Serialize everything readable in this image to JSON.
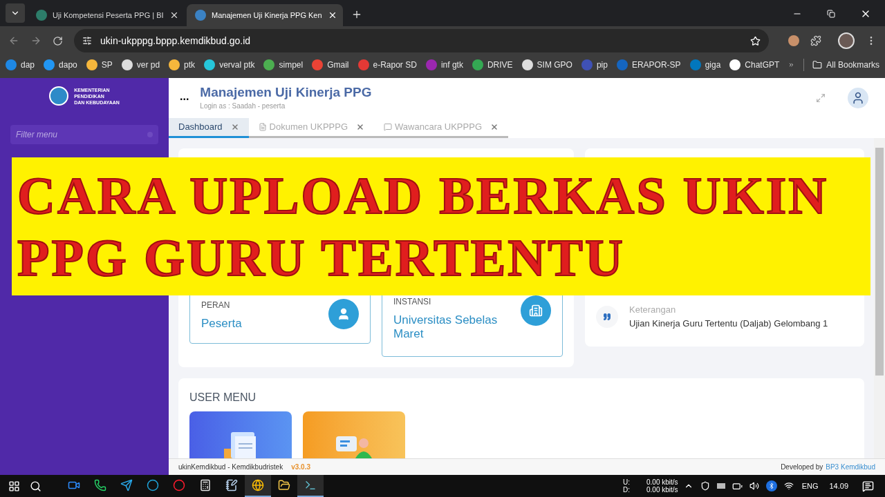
{
  "browser": {
    "tabs": [
      {
        "title": "Uji Kompetensi Peserta PPG | BI",
        "selected": false
      },
      {
        "title": "Manajemen Uji Kinerja PPG Ken",
        "selected": true
      }
    ],
    "address": "ukin-ukpppg.bppp.kemdikbud.go.id",
    "bookmarks": [
      {
        "label": "dap"
      },
      {
        "label": "dapo"
      },
      {
        "label": "SP"
      },
      {
        "label": "ver pd"
      },
      {
        "label": "ptk"
      },
      {
        "label": "verval ptk"
      },
      {
        "label": "simpel"
      },
      {
        "label": "Gmail"
      },
      {
        "label": "e-Rapor SD"
      },
      {
        "label": "inf gtk"
      },
      {
        "label": "DRIVE"
      },
      {
        "label": "SIM GPO"
      },
      {
        "label": "pip"
      },
      {
        "label": "ERAPOR-SP"
      },
      {
        "label": "giga"
      },
      {
        "label": "ChatGPT"
      }
    ],
    "all_bookmarks": "All Bookmarks"
  },
  "sidebar": {
    "logo_lines": [
      "KEMENTERIAN",
      "PENDIDIKAN",
      "DAN KEBUDAYAAN"
    ],
    "filter_placeholder": "Filter menu"
  },
  "header": {
    "menu_dots": "...",
    "title": "Manajemen Uji Kinerja PPG",
    "subtitle": "Login as : Saadah - peserta"
  },
  "app_tabs": [
    {
      "label": "Dashboard",
      "selected": true,
      "kind": "plain"
    },
    {
      "label": "Dokumen UKPPPG",
      "selected": false,
      "kind": "document"
    },
    {
      "label": "Wawancara UKPPPG",
      "selected": false,
      "kind": "chat"
    }
  ],
  "profile_cards": [
    {
      "label": "PERAN",
      "value": "Peserta",
      "kind": "user"
    },
    {
      "label": "INSTANSI",
      "value": "Universitas Sebelas Maret",
      "kind": "building"
    }
  ],
  "info_items": [
    {
      "label": "Keterangan",
      "value": "Ujian Kinerja Guru Tertentu (Daljab) Gelombang 1"
    }
  ],
  "user_menu": {
    "title": "USER MENU",
    "tiles": [
      {
        "kind": "documents"
      },
      {
        "kind": "chat"
      }
    ]
  },
  "banner": {
    "lines": [
      "CARA UPLOAD BERKAS UKIN",
      "PPG GURU TERTENTU"
    ]
  },
  "footer": {
    "left": "ukinKemdikbud - Kemdikbudristek",
    "version": "v3.0.3",
    "developed_by": "Developed by",
    "link": "BP3 Kemdikbud"
  },
  "taskbar": {
    "apps": [
      {
        "kind": "zoom",
        "active": false
      },
      {
        "kind": "whatsapp",
        "active": false
      },
      {
        "kind": "telegram",
        "active": false
      },
      {
        "kind": "edge",
        "active": false
      },
      {
        "kind": "opera",
        "active": false
      },
      {
        "kind": "calculator",
        "active": false
      },
      {
        "kind": "notepad",
        "active": false
      },
      {
        "kind": "chrome",
        "active": true
      },
      {
        "kind": "explorer",
        "active": false
      },
      {
        "kind": "terminal",
        "active": true
      }
    ],
    "upload_label": "U:",
    "download_label": "D:",
    "upload_speed": "0.00 kbit/s",
    "download_speed": "0.00 kbit/s",
    "language": "ENG",
    "time": "14.09"
  }
}
